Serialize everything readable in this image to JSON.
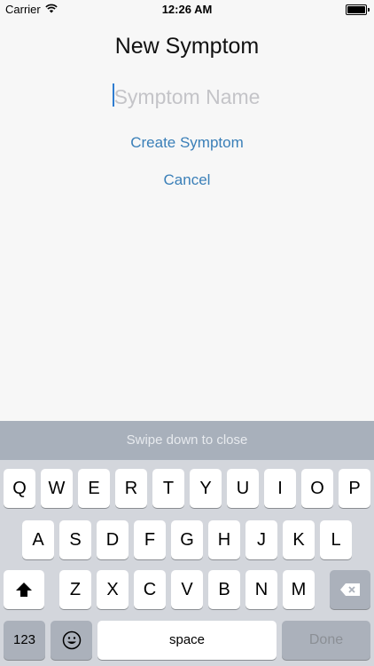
{
  "status_bar": {
    "carrier": "Carrier",
    "time": "12:26 AM"
  },
  "form": {
    "title": "New Symptom",
    "name_placeholder": "Symptom Name",
    "name_value": "",
    "create_label": "Create Symptom",
    "cancel_label": "Cancel"
  },
  "keyboard": {
    "accessory_text": "Swipe down to close",
    "row1": [
      "Q",
      "W",
      "E",
      "R",
      "T",
      "Y",
      "U",
      "I",
      "O",
      "P"
    ],
    "row2": [
      "A",
      "S",
      "D",
      "F",
      "G",
      "H",
      "J",
      "K",
      "L"
    ],
    "row3": [
      "Z",
      "X",
      "C",
      "V",
      "B",
      "N",
      "M"
    ],
    "numbers_label": "123",
    "space_label": "space",
    "done_label": "Done"
  },
  "colors": {
    "accent": "#3a7fb8",
    "cursor": "#2f7dd1",
    "background": "#f7f7f7"
  },
  "icons": {
    "shift": "shift-icon",
    "backspace": "backspace-icon",
    "emoji": "emoji-icon",
    "wifi": "wifi-icon",
    "battery": "battery-icon"
  }
}
